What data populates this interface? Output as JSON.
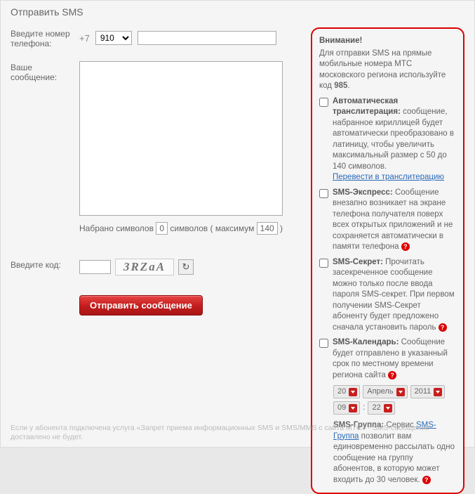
{
  "page_title": "Отправить SMS",
  "form": {
    "phone_label": "Введите номер телефона:",
    "prefix": "+7",
    "code_selected": "910",
    "phone_value": "",
    "message_label": "Ваше сообщение:",
    "message_value": "",
    "counter_prefix": "Набрано символов",
    "counter_value": "0",
    "counter_mid": "символов ( максимум",
    "counter_max": "140",
    "counter_suffix": ")",
    "captcha_label": "Введите код:",
    "captcha_value": "",
    "captcha_text": "3RZaA",
    "submit_label": "Отправить сообщение"
  },
  "info": {
    "attention_title": "Внимание!",
    "attention_text": "Для отправки SMS на прямые мобильные номера МТС московского региона используйте код ",
    "attention_code": "985",
    "options": [
      {
        "title": "Автоматическая транслитерация:",
        "text": " сообщение, набранное кириллицей будет автоматически преобразовано в латиницу, чтобы увеличить максимальный размер с 50 до 140 символов.",
        "link": "Перевести в транслитерацию"
      },
      {
        "title": "SMS-Экспресс:",
        "text": " Сообщение внезапно возникает на экране телефона получателя поверх всех открытых приложений и не сохраняется автоматически в памяти телефона",
        "help": true
      },
      {
        "title": "SMS-Секрет:",
        "text": " Прочитать засекреченное сообщение можно только после ввода пароля SMS-секрет. При первом получении SMS-Секрет абоненту будет предложено сначала установить пароль",
        "help": true
      },
      {
        "title": "SMS-Календарь:",
        "text": " Сообщение будет отправлено в указанный срок по местному времени региона сайта",
        "help": true
      }
    ],
    "date": {
      "day": "20",
      "month": "Апрель",
      "year": "2011",
      "hour": "09",
      "minute": "22"
    },
    "group": {
      "title": "SMS-Группа:",
      "pre": " Сервис ",
      "link": "SMS-Группа",
      "text": " позволит вам единовременно рассылать одно сообщение на группу абонентов, в которую может входить до 30 человек.",
      "help": true
    }
  },
  "footer": "Если у абонента подключена услуга «Запрет приема информационных SMS и SMS/MMS с сайта МТС» - SMS-сообщение доставлено не будет."
}
